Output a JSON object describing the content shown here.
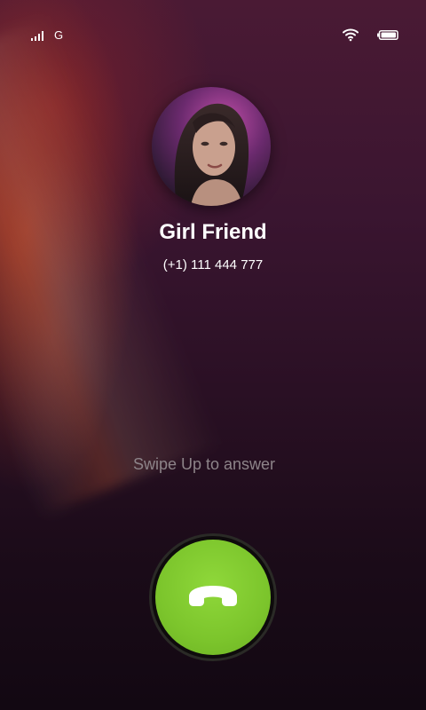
{
  "status_bar": {
    "network_type": "G",
    "icons": [
      "signal-icon",
      "wifi-icon",
      "battery-icon"
    ]
  },
  "caller": {
    "name": "Girl Friend",
    "number": "(+1) 111 444 777",
    "avatar_icon": "avatar"
  },
  "call": {
    "swipe_hint": "Swipe Up to answer",
    "answer_icon": "phone-icon",
    "answer_color": "#7cc52c"
  },
  "colors": {
    "background_top": "#4a1a34",
    "background_bottom": "#120812",
    "accent_green": "#7cc52c",
    "hint_text": "#8d8489"
  }
}
